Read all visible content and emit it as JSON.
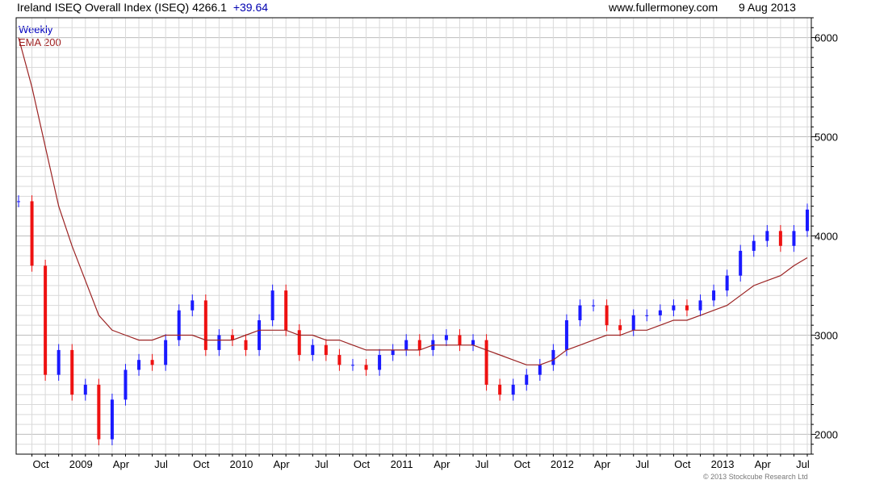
{
  "header": {
    "title": "Ireland ISEQ Overall Index (ISEQ)",
    "last": "4266.1",
    "change": "+39.64",
    "source": "www.fullermoney.com",
    "date": "9 Aug 2013"
  },
  "legend": {
    "frequency": "Weekly",
    "ema": "EMA 200"
  },
  "copyright": "© 2013 Stockcube Research Ltd",
  "colors": {
    "up": "#1a1aff",
    "down": "#ee1111",
    "ema": "#9b2222",
    "grid": "#d9d9d9",
    "major_grid": "#bdbdbd"
  },
  "chart_data": {
    "type": "line",
    "subtype": "weekly candlestick with EMA",
    "ylim": [
      1800,
      6200
    ],
    "y_ticks": [
      2000,
      3000,
      4000,
      5000,
      6000
    ],
    "y_tick_labels": [
      "2000",
      "3000",
      "4000",
      "5000",
      "6000"
    ],
    "x_tick_labels": [
      "Oct",
      "2009",
      "Apr",
      "Jul",
      "Oct",
      "2010",
      "Apr",
      "Jul",
      "Oct",
      "2011",
      "Apr",
      "Jul",
      "Oct",
      "2012",
      "Apr",
      "Jul",
      "Oct",
      "2013",
      "Apr",
      "Jul"
    ],
    "x_range": [
      "2008-09",
      "2013-08"
    ],
    "grid": true,
    "series": [
      {
        "name": "Weekly",
        "points": [
          [
            "2008-09",
            4350
          ],
          [
            "2008-10",
            3700
          ],
          [
            "2008-11",
            2600
          ],
          [
            "2008-12",
            2850
          ],
          [
            "2009-01",
            2400
          ],
          [
            "2009-02",
            2500
          ],
          [
            "2009-03",
            1950
          ],
          [
            "2009-04",
            2350
          ],
          [
            "2009-05",
            2650
          ],
          [
            "2009-06",
            2750
          ],
          [
            "2009-07",
            2700
          ],
          [
            "2009-08",
            2950
          ],
          [
            "2009-09",
            3250
          ],
          [
            "2009-10",
            3350
          ],
          [
            "2009-11",
            2850
          ],
          [
            "2009-12",
            3000
          ],
          [
            "2010-01",
            2950
          ],
          [
            "2010-02",
            2850
          ],
          [
            "2010-03",
            3150
          ],
          [
            "2010-04",
            3450
          ],
          [
            "2010-05",
            3050
          ],
          [
            "2010-06",
            2800
          ],
          [
            "2010-07",
            2900
          ],
          [
            "2010-08",
            2800
          ],
          [
            "2010-09",
            2700
          ],
          [
            "2010-10",
            2700
          ],
          [
            "2010-11",
            2650
          ],
          [
            "2010-12",
            2800
          ],
          [
            "2011-01",
            2850
          ],
          [
            "2011-02",
            2950
          ],
          [
            "2011-03",
            2850
          ],
          [
            "2011-04",
            2950
          ],
          [
            "2011-05",
            3000
          ],
          [
            "2011-06",
            2900
          ],
          [
            "2011-07",
            2950
          ],
          [
            "2011-08",
            2500
          ],
          [
            "2011-09",
            2400
          ],
          [
            "2011-10",
            2500
          ],
          [
            "2011-11",
            2600
          ],
          [
            "2011-12",
            2700
          ],
          [
            "2012-01",
            2850
          ],
          [
            "2012-02",
            3150
          ],
          [
            "2012-03",
            3300
          ],
          [
            "2012-04",
            3300
          ],
          [
            "2012-05",
            3100
          ],
          [
            "2012-06",
            3050
          ],
          [
            "2012-07",
            3200
          ],
          [
            "2012-08",
            3200
          ],
          [
            "2012-09",
            3250
          ],
          [
            "2012-10",
            3300
          ],
          [
            "2012-11",
            3250
          ],
          [
            "2012-12",
            3350
          ],
          [
            "2013-01",
            3450
          ],
          [
            "2013-02",
            3600
          ],
          [
            "2013-03",
            3850
          ],
          [
            "2013-04",
            3950
          ],
          [
            "2013-05",
            4050
          ],
          [
            "2013-06",
            3900
          ],
          [
            "2013-07",
            4050
          ],
          [
            "2013-08",
            4266
          ]
        ]
      },
      {
        "name": "EMA 200",
        "points": [
          [
            "2008-09",
            6000
          ],
          [
            "2008-10",
            5500
          ],
          [
            "2008-11",
            4900
          ],
          [
            "2008-12",
            4300
          ],
          [
            "2009-01",
            3900
          ],
          [
            "2009-02",
            3550
          ],
          [
            "2009-03",
            3200
          ],
          [
            "2009-04",
            3050
          ],
          [
            "2009-05",
            3000
          ],
          [
            "2009-06",
            2950
          ],
          [
            "2009-07",
            2950
          ],
          [
            "2009-08",
            3000
          ],
          [
            "2009-09",
            3000
          ],
          [
            "2009-10",
            3000
          ],
          [
            "2009-11",
            2950
          ],
          [
            "2009-12",
            2950
          ],
          [
            "2010-01",
            2950
          ],
          [
            "2010-02",
            3000
          ],
          [
            "2010-03",
            3050
          ],
          [
            "2010-04",
            3050
          ],
          [
            "2010-05",
            3050
          ],
          [
            "2010-06",
            3000
          ],
          [
            "2010-07",
            3000
          ],
          [
            "2010-08",
            2950
          ],
          [
            "2010-09",
            2950
          ],
          [
            "2010-10",
            2900
          ],
          [
            "2010-11",
            2850
          ],
          [
            "2010-12",
            2850
          ],
          [
            "2011-01",
            2850
          ],
          [
            "2011-02",
            2850
          ],
          [
            "2011-03",
            2850
          ],
          [
            "2011-04",
            2900
          ],
          [
            "2011-05",
            2900
          ],
          [
            "2011-06",
            2900
          ],
          [
            "2011-07",
            2900
          ],
          [
            "2011-08",
            2850
          ],
          [
            "2011-09",
            2800
          ],
          [
            "2011-10",
            2750
          ],
          [
            "2011-11",
            2700
          ],
          [
            "2011-12",
            2700
          ],
          [
            "2012-01",
            2750
          ],
          [
            "2012-02",
            2850
          ],
          [
            "2012-03",
            2900
          ],
          [
            "2012-04",
            2950
          ],
          [
            "2012-05",
            3000
          ],
          [
            "2012-06",
            3000
          ],
          [
            "2012-07",
            3050
          ],
          [
            "2012-08",
            3050
          ],
          [
            "2012-09",
            3100
          ],
          [
            "2012-10",
            3150
          ],
          [
            "2012-11",
            3150
          ],
          [
            "2012-12",
            3200
          ],
          [
            "2013-01",
            3250
          ],
          [
            "2013-02",
            3300
          ],
          [
            "2013-03",
            3400
          ],
          [
            "2013-04",
            3500
          ],
          [
            "2013-05",
            3550
          ],
          [
            "2013-06",
            3600
          ],
          [
            "2013-07",
            3700
          ],
          [
            "2013-08",
            3780
          ]
        ]
      }
    ]
  }
}
